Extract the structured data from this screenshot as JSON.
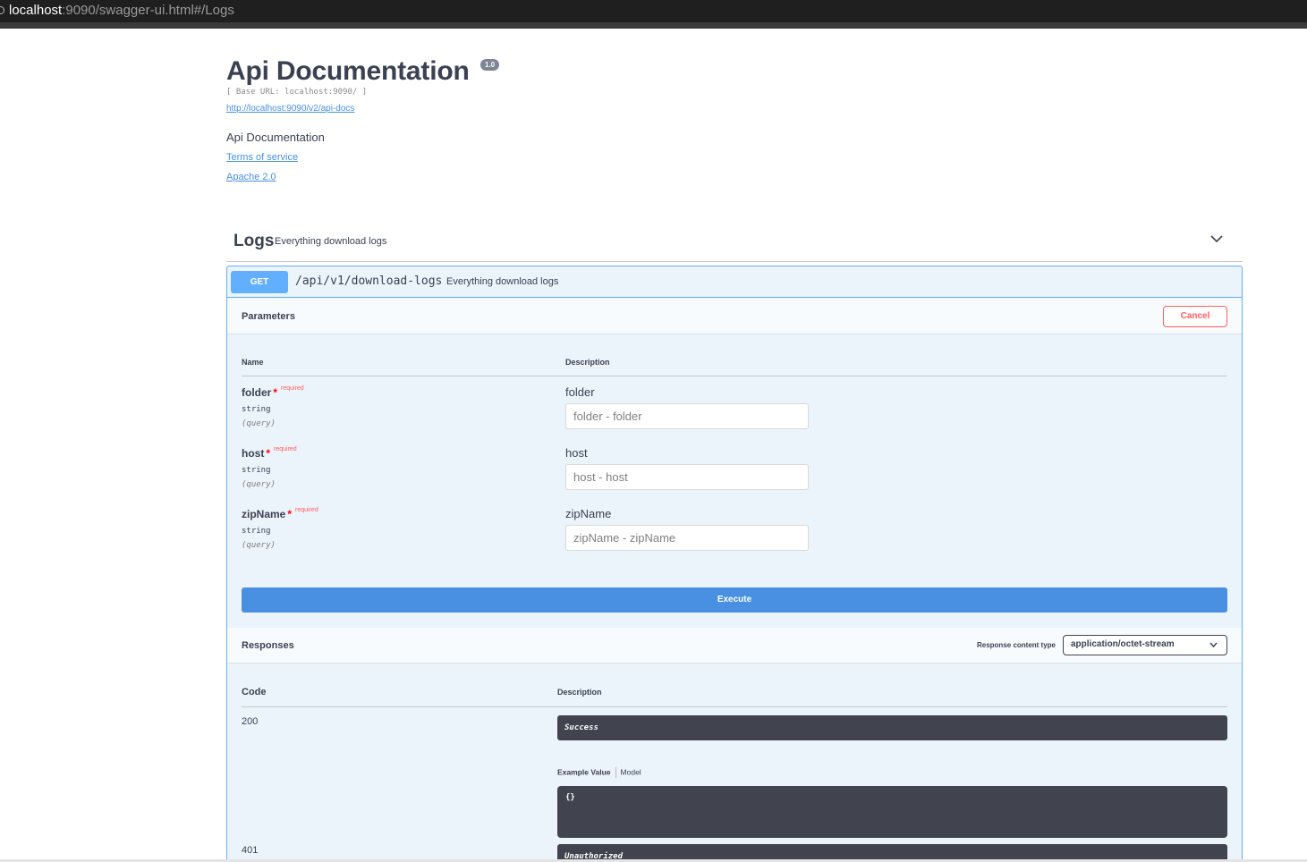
{
  "browser": {
    "url_host": "localhost",
    "url_rest": ":9090/swagger-ui.html#/Logs"
  },
  "info": {
    "title": "Api Documentation",
    "version": "1.0",
    "base_url": "[ Base URL: localhost:9090/ ]",
    "api_docs_link": "http://localhost:9090/v2/api-docs",
    "description": "Api Documentation",
    "terms_link": "Terms of service",
    "license_link": "Apache 2.0"
  },
  "tag": {
    "name": "Logs",
    "description": "Everything download logs",
    "expanded_icon": "chevron-down-icon"
  },
  "operation": {
    "method": "GET",
    "path": "/api/v1/download-logs",
    "summary": "Everything download logs",
    "parameters_title": "Parameters",
    "cancel_label": "Cancel",
    "col_name": "Name",
    "col_description": "Description",
    "required_star": "*",
    "required_label": "required",
    "params": [
      {
        "name": "folder",
        "type": "string",
        "in": "(query)",
        "description": "folder",
        "placeholder": "folder - folder"
      },
      {
        "name": "host",
        "type": "string",
        "in": "(query)",
        "description": "host",
        "placeholder": "host - host"
      },
      {
        "name": "zipName",
        "type": "string",
        "in": "(query)",
        "description": "zipName",
        "placeholder": "zipName - zipName"
      }
    ],
    "execute_label": "Execute",
    "responses_title": "Responses",
    "response_content_type_label": "Response content type",
    "response_content_type_value": "application/octet-stream",
    "col_code": "Code",
    "col_resp_description": "Description",
    "responses": [
      {
        "code": "200",
        "description": "Success"
      },
      {
        "code": "401",
        "description": "Unauthorized"
      }
    ],
    "example_value_tab": "Example Value",
    "model_tab": "Model",
    "example_body": "{}"
  },
  "colors": {
    "get": "#61affe",
    "execute": "#4990e2",
    "cancel": "#ff6060",
    "dark": "#41444e"
  }
}
